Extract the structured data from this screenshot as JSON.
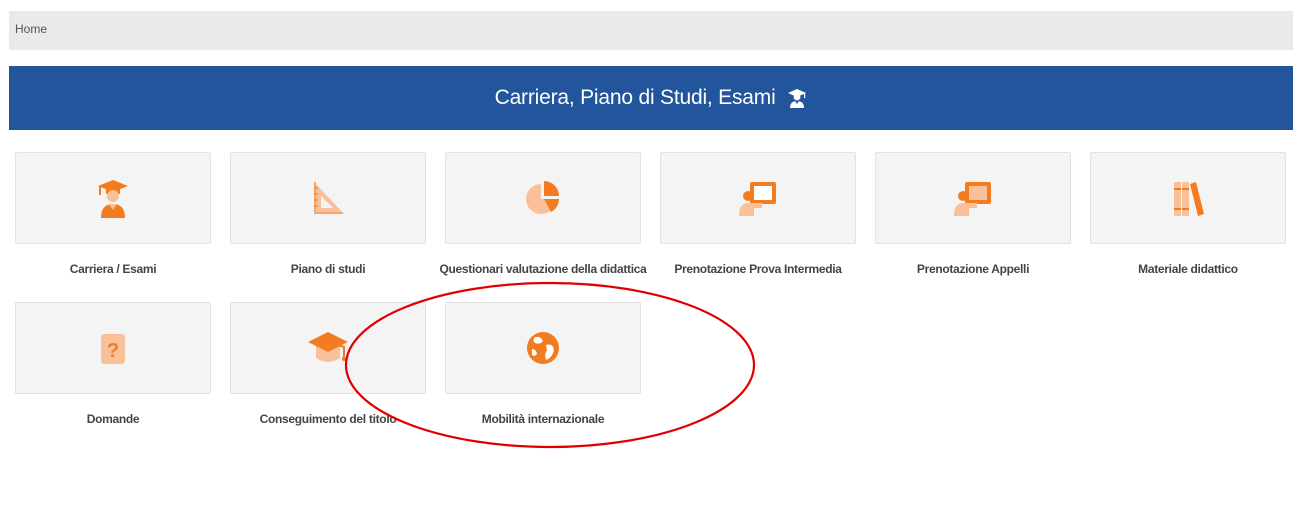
{
  "breadcrumb": {
    "home": "Home"
  },
  "banner": {
    "title": "Carriera, Piano di Studi, Esami",
    "icon": "graduate-student-icon",
    "color": "#22559c"
  },
  "accent_color": "#f47c20",
  "tiles": [
    {
      "label": "Carriera / Esami",
      "icon": "graduate-student-icon"
    },
    {
      "label": "Piano di studi",
      "icon": "set-square-ruler-icon"
    },
    {
      "label": "Questionari valutazione della didattica",
      "icon": "pie-chart-icon"
    },
    {
      "label": "Prenotazione Prova Intermedia",
      "icon": "teacher-board-icon"
    },
    {
      "label": "Prenotazione Appelli",
      "icon": "teacher-board-icon"
    },
    {
      "label": "Materiale didattico",
      "icon": "books-icon"
    },
    {
      "label": "Domande",
      "icon": "question-mark-icon"
    },
    {
      "label": "Conseguimento del titolo",
      "icon": "mortarboard-icon"
    },
    {
      "label": "Mobilità internazionale",
      "icon": "globe-icon"
    }
  ],
  "annotation": {
    "shape": "ellipse",
    "color": "#e00000"
  }
}
